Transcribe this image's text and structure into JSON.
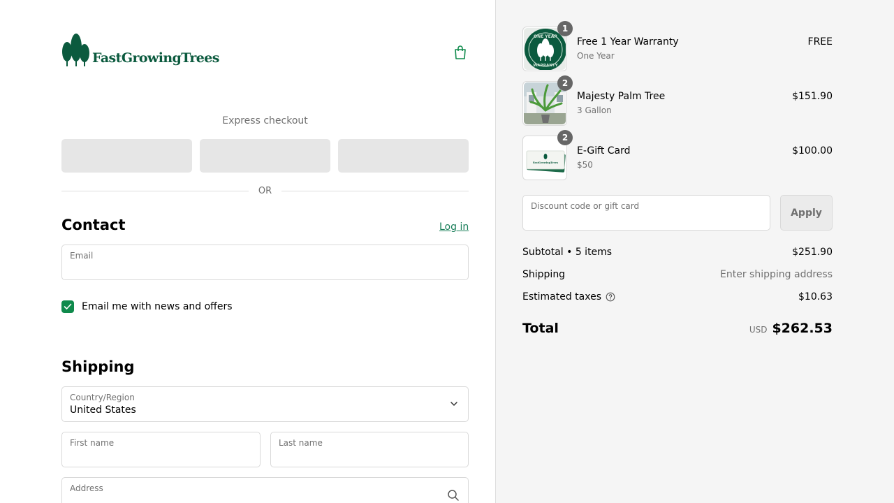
{
  "brand": {
    "name": "FastGrowingTrees",
    "color": "#0b5a3e"
  },
  "express": {
    "title": "Express checkout",
    "or_text": "OR"
  },
  "contact": {
    "heading": "Contact",
    "login_label": "Log in",
    "email_label": "Email",
    "newsletter_label": "Email me with news and offers",
    "newsletter_checked": true
  },
  "shipping": {
    "heading": "Shipping",
    "country_label": "Country/Region",
    "country_value": "United States",
    "first_name_label": "First name",
    "last_name_label": "Last name",
    "address_label": "Address"
  },
  "cart": {
    "items": [
      {
        "name": "Free 1 Year Warranty",
        "variant": "One Year",
        "price": "FREE",
        "qty": "1",
        "image": "warranty-badge"
      },
      {
        "name": "Majesty Palm Tree",
        "variant": "3 Gallon",
        "price": "$151.90",
        "qty": "2",
        "image": "palm-tree-photo"
      },
      {
        "name": "E-Gift Card",
        "variant": "$50",
        "price": "$100.00",
        "qty": "2",
        "image": "gift-card"
      }
    ],
    "warranty_badge_text": {
      "top": "ONE YEAR",
      "bottom": "WARRANTY"
    },
    "gift_card_text": "FastGrowingTrees"
  },
  "discount": {
    "placeholder": "Discount code or gift card",
    "apply_label": "Apply"
  },
  "summary": {
    "subtotal_label": "Subtotal • 5 items",
    "subtotal_value": "$251.90",
    "shipping_label": "Shipping",
    "shipping_value": "Enter shipping address",
    "taxes_label": "Estimated taxes",
    "taxes_value": "$10.63",
    "total_label": "Total",
    "total_currency": "USD",
    "total_value": "$262.53"
  },
  "colors": {
    "accent": "#0f8a4c",
    "link": "#1a7f5a",
    "sidebar_bg": "#f5f5f5"
  }
}
